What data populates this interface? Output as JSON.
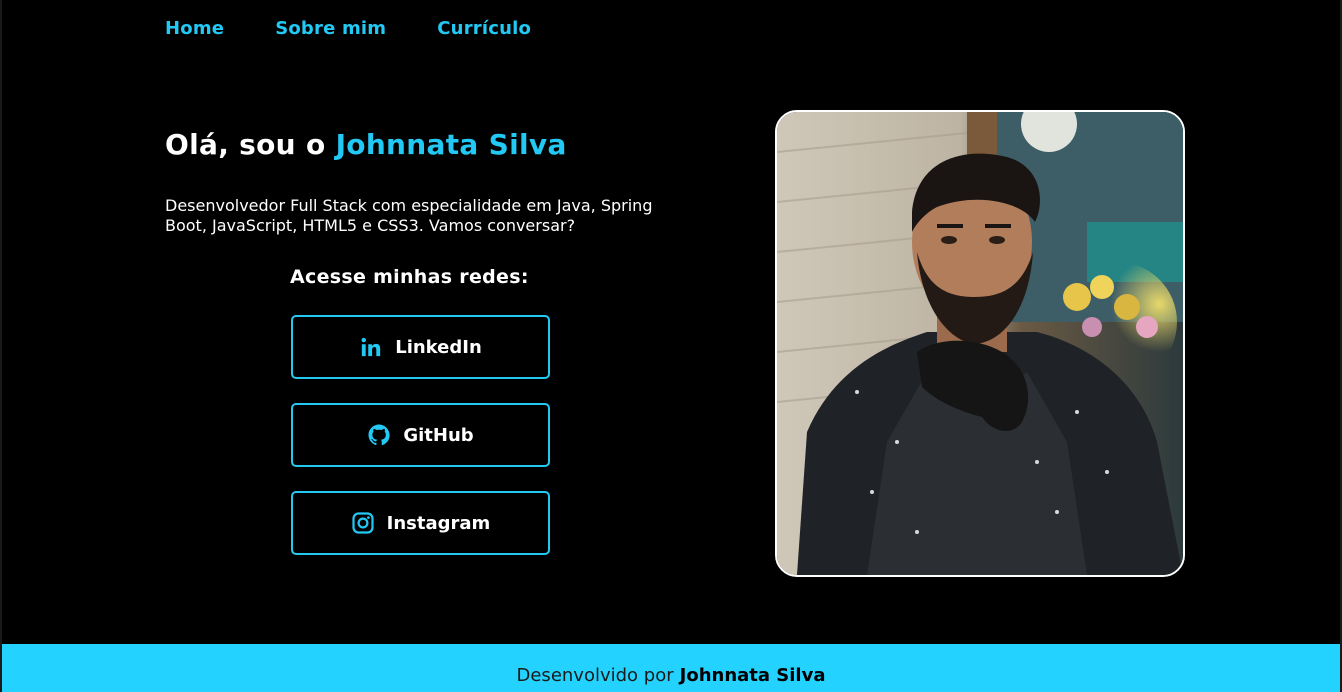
{
  "nav": {
    "items": [
      {
        "label": "Home"
      },
      {
        "label": "Sobre mim"
      },
      {
        "label": "Currículo"
      }
    ]
  },
  "hero": {
    "greeting": "Olá, sou o",
    "name": "Johnnata Silva",
    "description": "Desenvolvedor Full Stack com especialidade em Java, Spring Boot, JavaScript, HTML5 e CSS3. Vamos conversar?"
  },
  "social": {
    "heading": "Acesse minhas redes:",
    "buttons": [
      {
        "label": "LinkedIn",
        "icon": "linkedin-icon"
      },
      {
        "label": "GitHub",
        "icon": "github-icon"
      },
      {
        "label": "Instagram",
        "icon": "instagram-icon"
      }
    ]
  },
  "footer": {
    "prefix": "Desenvolvido por",
    "name": "Johnnata Silva"
  },
  "colors": {
    "accent": "#23c9f5",
    "footer_bg": "#23d2ff",
    "background": "#000000",
    "text": "#ffffff"
  }
}
